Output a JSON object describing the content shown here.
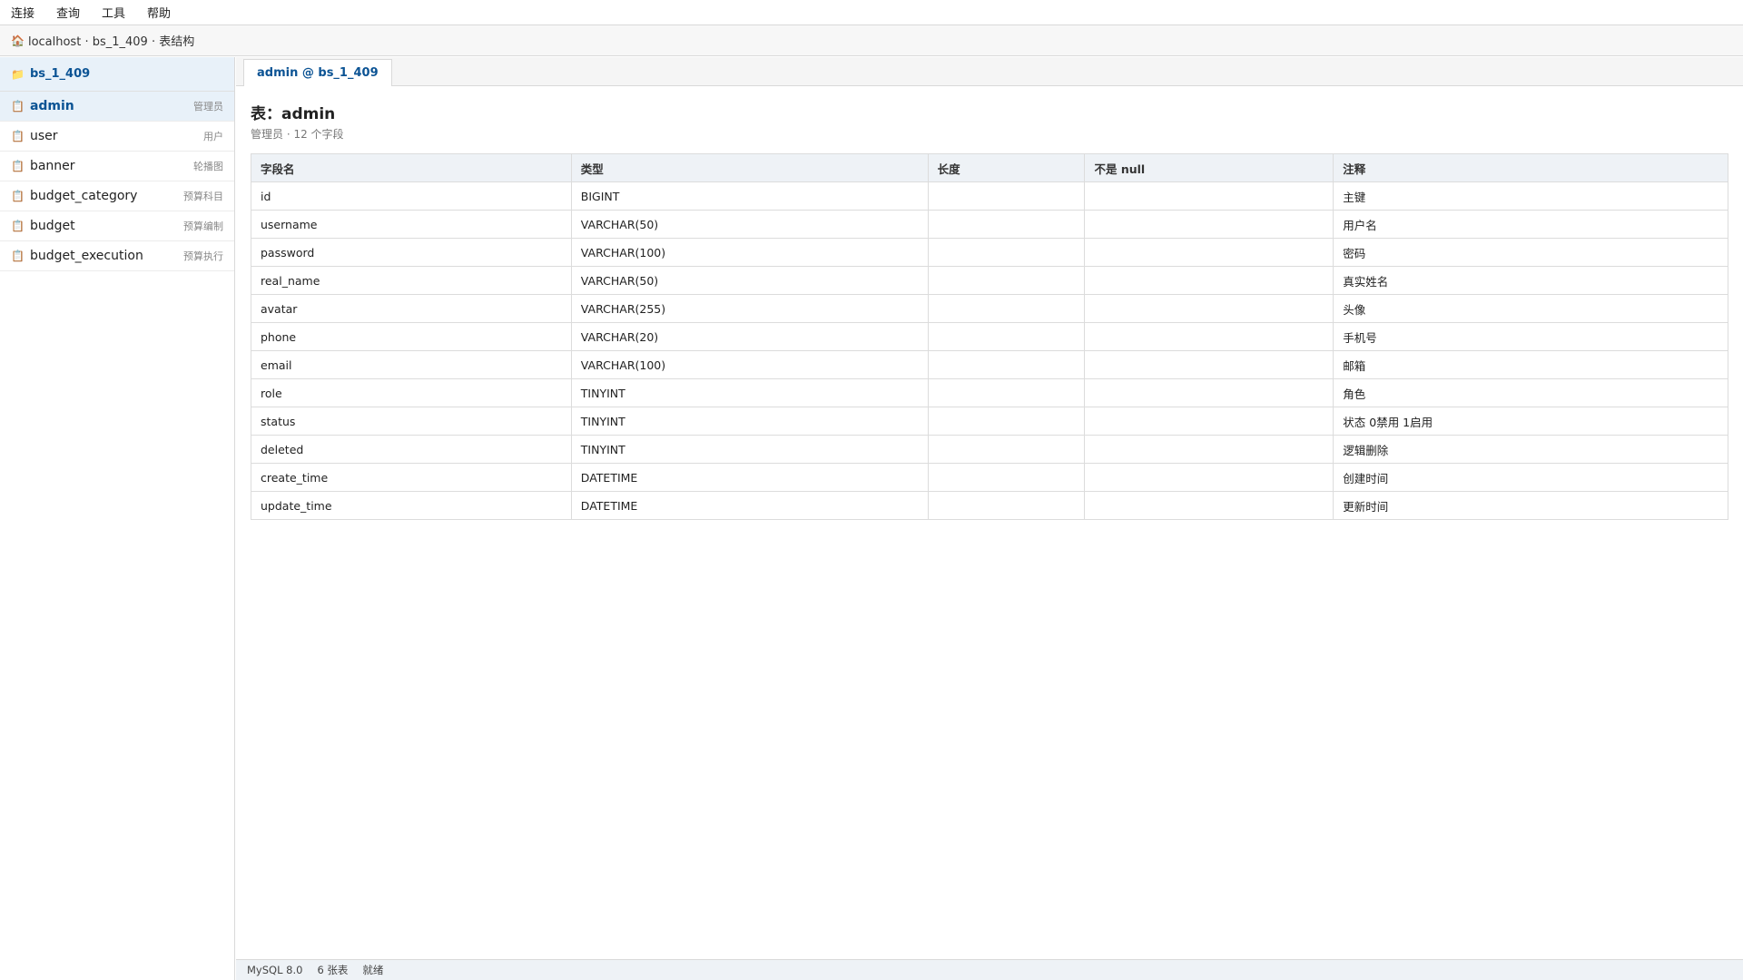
{
  "menu": [
    "连接",
    "查询",
    "工具",
    "帮助"
  ],
  "breadcrumb": {
    "icon": "home-icon",
    "text": "localhost · bs_1_409 · 表结构"
  },
  "sidebar": {
    "database": {
      "icon": "folder-icon",
      "label": "bs_1_409"
    },
    "tables": [
      {
        "icon": "table-icon",
        "name": "admin",
        "comment": "管理员",
        "active": true
      },
      {
        "icon": "table-icon",
        "name": "user",
        "comment": "用户"
      },
      {
        "icon": "table-icon",
        "name": "banner",
        "comment": "轮播图"
      },
      {
        "icon": "table-icon",
        "name": "budget_category",
        "comment": "预算科目"
      },
      {
        "icon": "table-icon",
        "name": "budget",
        "comment": "预算编制"
      },
      {
        "icon": "table-icon",
        "name": "budget_execution",
        "comment": "预算执行"
      }
    ]
  },
  "tab": {
    "label": "admin @ bs_1_409"
  },
  "main": {
    "title": "表：admin",
    "subtitle": "管理员 · 12 个字段",
    "columns": [
      "字段名",
      "类型",
      "长度",
      "不是 null",
      "注释"
    ],
    "rows": [
      [
        "id",
        "BIGINT",
        "",
        "",
        "主键"
      ],
      [
        "username",
        "VARCHAR(50)",
        "",
        "",
        "用户名"
      ],
      [
        "password",
        "VARCHAR(100)",
        "",
        "",
        "密码"
      ],
      [
        "real_name",
        "VARCHAR(50)",
        "",
        "",
        "真实姓名"
      ],
      [
        "avatar",
        "VARCHAR(255)",
        "",
        "",
        "头像"
      ],
      [
        "phone",
        "VARCHAR(20)",
        "",
        "",
        "手机号"
      ],
      [
        "email",
        "VARCHAR(100)",
        "",
        "",
        "邮箱"
      ],
      [
        "role",
        "TINYINT",
        "",
        "",
        "角色"
      ],
      [
        "status",
        "TINYINT",
        "",
        "",
        "状态 0禁用 1启用"
      ],
      [
        "deleted",
        "TINYINT",
        "",
        "",
        "逻辑删除"
      ],
      [
        "create_time",
        "DATETIME",
        "",
        "",
        "创建时间"
      ],
      [
        "update_time",
        "DATETIME",
        "",
        "",
        "更新时间"
      ]
    ]
  },
  "status": [
    "MySQL 8.0",
    "6 张表",
    "就绪"
  ]
}
